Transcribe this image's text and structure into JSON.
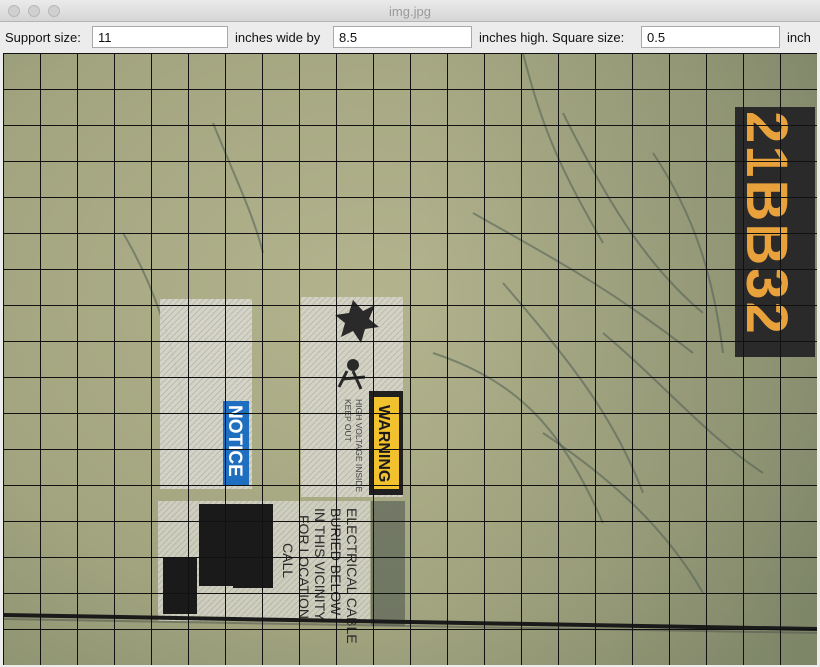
{
  "window": {
    "title": "img.jpg"
  },
  "toolbar": {
    "support_label": "Support size:",
    "width_value": "11",
    "wide_label": "inches wide by",
    "height_value": "8.5",
    "high_label": "inches high. Square size:",
    "square_value": "0.5",
    "unit_label": "inch"
  },
  "photo": {
    "notice_text": "NOTICE",
    "warning_text": "WARNING",
    "high_voltage_text": "HIGH VOLTAGE INSIDE",
    "keep_out_text": "KEEP OUT",
    "cable_line1": "ELECTRICAL CABLE",
    "cable_line2": "BURIED BELOW",
    "cable_line3": "IN THIS VICINITY",
    "cable_line4": "FOR LOCATION",
    "cable_line5": "CALL",
    "marker_code": "21BB32",
    "colors": {
      "ground": "#a9aa86",
      "notice_blue": "#1f6fc0",
      "warning_yellow": "#f2c12e",
      "marker_orange": "#e9a23b",
      "grid_line": "#111111"
    }
  }
}
